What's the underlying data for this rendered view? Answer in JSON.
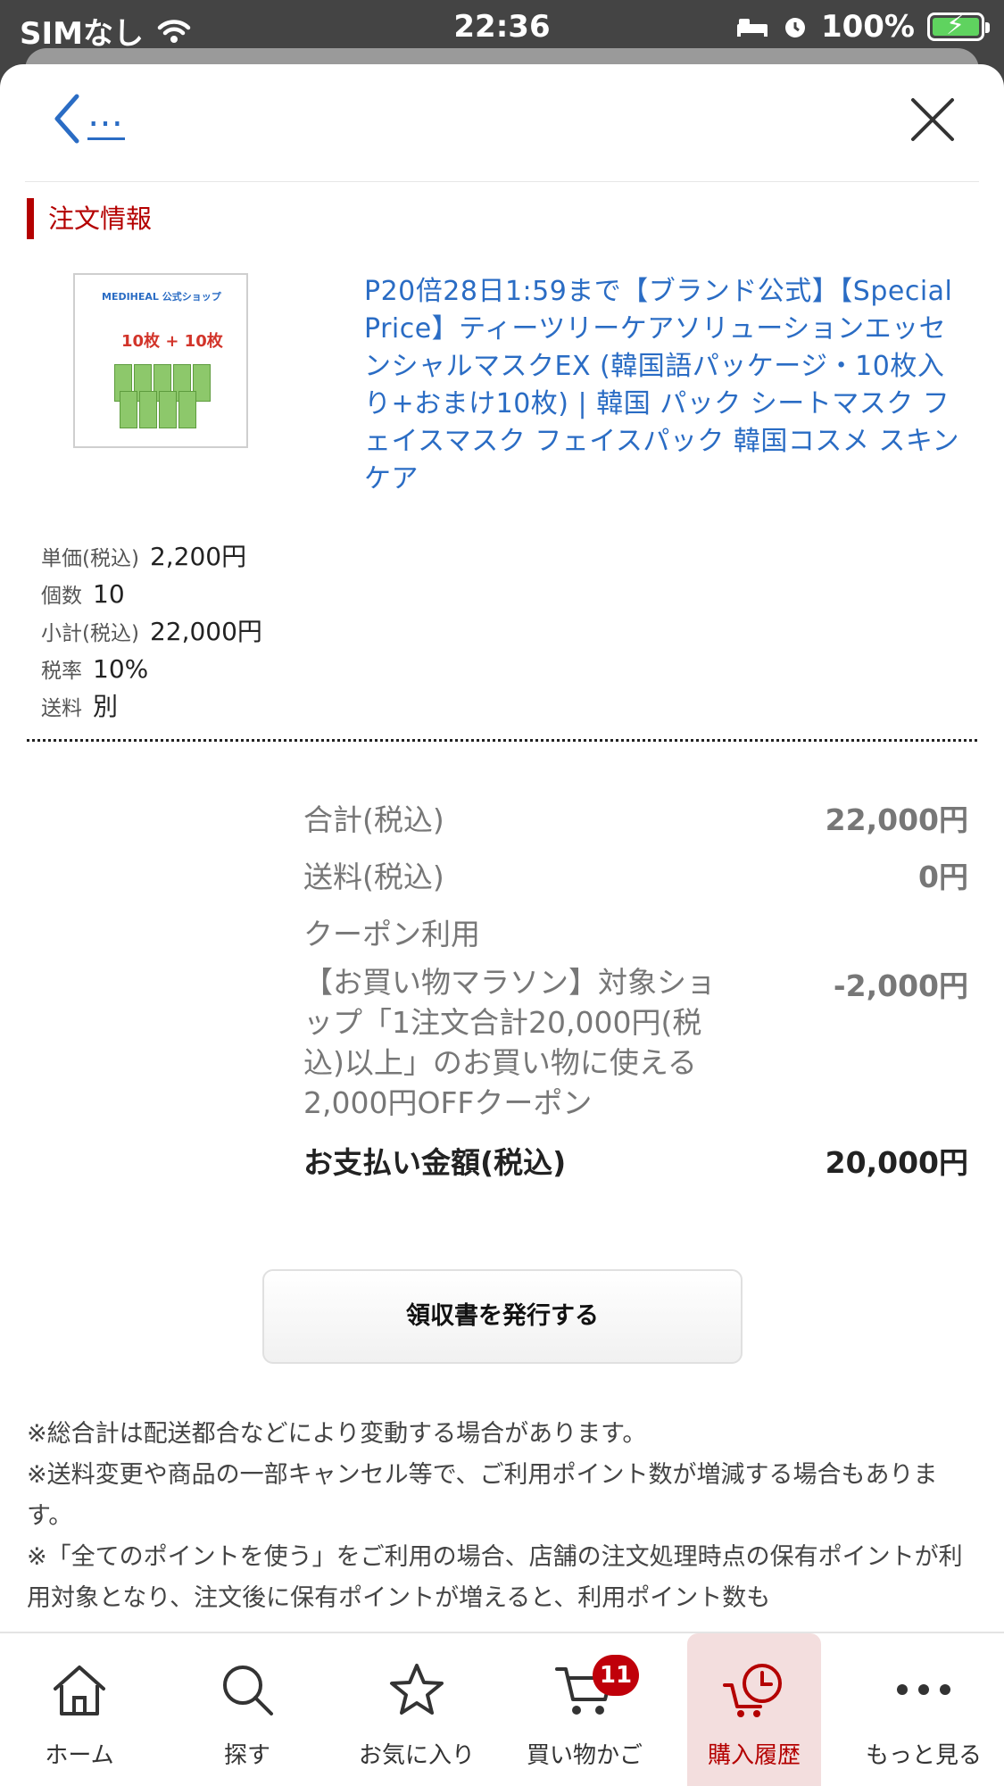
{
  "status_bar": {
    "carrier": "SIMなし",
    "time": "22:36",
    "battery": "100%"
  },
  "nav": {
    "back_label": "…",
    "close_icon": "close-icon"
  },
  "section": {
    "title": "注文情報"
  },
  "product": {
    "thumbnail_brand": "MEDIHEAL 公式ショップ",
    "thumbnail_promo": "10枚 + 10枚",
    "title": "P20倍28日1:59まで【ブランド公式】【Special Price】ティーツリーケアソリューションエッセンシャルマスクEX (韓国語パッケージ・10枚入り+おまけ10枚) | 韓国 パック シートマスク フェイスマスク フェイスパック 韓国コスメ スキンケア"
  },
  "details": [
    {
      "key": "単価(税込)",
      "value": "2,200円"
    },
    {
      "key": "個数",
      "value": "10"
    },
    {
      "key": "小計(税込)",
      "value": "22,000円"
    },
    {
      "key": "税率",
      "value": "10%"
    },
    {
      "key": "送料",
      "value": "別"
    }
  ],
  "totals": {
    "subtotal_label": "合計(税込)",
    "subtotal_value": "22,000円",
    "shipping_label": "送料(税込)",
    "shipping_value": "0円",
    "coupon_label": "クーポン利用",
    "coupon_name": "【お買い物マラソン】対象ショップ「1注文合計20,000円(税込)以上」のお買い物に使える2,000円OFFクーポン",
    "coupon_value": "-2,000円",
    "payment_label": "お支払い金額(税込)",
    "payment_value": "20,000円"
  },
  "receipt_button": "領収書を発行する",
  "notes": [
    "※総合計は配送都合などにより変動する場合があります。",
    "※送料変更や商品の一部キャンセル等で、ご利用ポイント数が増減する場合もあります。",
    "※「全てのポイントを使う」をご利用の場合、店舗の注文処理時点の保有ポイントが利用対象となり、注文後に保有ポイントが増えると、利用ポイント数も"
  ],
  "tabs": [
    {
      "label": "ホーム",
      "icon": "home-icon"
    },
    {
      "label": "探す",
      "icon": "search-icon"
    },
    {
      "label": "お気に入り",
      "icon": "star-icon"
    },
    {
      "label": "買い物かご",
      "icon": "cart-icon",
      "badge": "11"
    },
    {
      "label": "購入履歴",
      "icon": "purchase-history-icon",
      "active": true
    },
    {
      "label": "もっと見る",
      "icon": "more-icon"
    }
  ],
  "colors": {
    "accent_red": "#b40000",
    "link_blue": "#2a6cc4",
    "badge_red": "#c0000a"
  }
}
